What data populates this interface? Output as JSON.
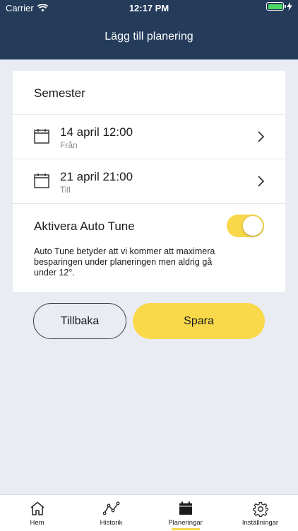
{
  "status_bar": {
    "carrier": "Carrier",
    "time": "12:17 PM"
  },
  "header": {
    "title": "Lägg till planering"
  },
  "form": {
    "name": "Semester",
    "from": {
      "value": "14 april 12:00",
      "label": "Från"
    },
    "to": {
      "value": "21 april 21:00",
      "label": "Till"
    },
    "auto_tune": {
      "label": "Aktivera Auto Tune",
      "enabled": true,
      "description": "Auto Tune betyder att vi kommer att maximera besparingen under planeringen men aldrig gå under 12°."
    }
  },
  "buttons": {
    "back_label": "Tillbaka",
    "save_label": "Spara"
  },
  "tabbar": {
    "items": [
      {
        "label": "Hem",
        "icon": "home-icon"
      },
      {
        "label": "Historik",
        "icon": "history-icon"
      },
      {
        "label": "Planeringar",
        "icon": "calendar-icon",
        "active": true
      },
      {
        "label": "Inställningar",
        "icon": "gear-icon"
      }
    ]
  },
  "colors": {
    "header_bg": "#243b5a",
    "accent": "#f8d74b",
    "page_bg": "#eaecf3"
  }
}
